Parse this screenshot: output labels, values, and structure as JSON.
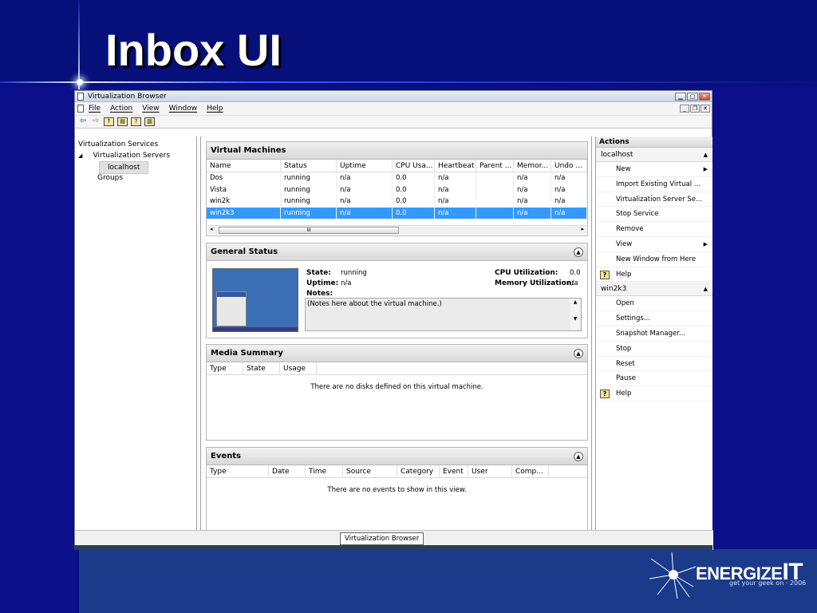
{
  "slide": {
    "title": "Inbox UI",
    "logo": {
      "brand": "ENERGIZE",
      "brand_suffix": "IT",
      "tagline": "get your geek on · 2006"
    }
  },
  "window": {
    "title": "Virtualization Browser",
    "menu": [
      "File",
      "Action",
      "View",
      "Window",
      "Help"
    ]
  },
  "tree": {
    "root": "Virtualization Services",
    "servers": "Virtualization Servers",
    "host": "localhost",
    "groups": "Groups"
  },
  "vm": {
    "heading": "Virtual Machines",
    "columns": [
      "Name",
      "Status",
      "Uptime",
      "CPU Usa...",
      "Heartbeat",
      "Parent ...",
      "Memor...",
      "Undo ..."
    ],
    "rows": [
      [
        "Dos",
        "running",
        "n/a",
        "0.0",
        "n/a",
        "",
        "n/a",
        "n/a"
      ],
      [
        "Vista",
        "running",
        "n/a",
        "0.0",
        "n/a",
        "",
        "n/a",
        "n/a"
      ],
      [
        "win2k",
        "running",
        "n/a",
        "0.0",
        "n/a",
        "",
        "n/a",
        "n/a"
      ],
      [
        "win2k3",
        "running",
        "n/a",
        "0.0",
        "n/a",
        "",
        "n/a",
        "n/a"
      ]
    ],
    "scroll_thumb": "III"
  },
  "general": {
    "heading": "General Status",
    "state_label": "State:",
    "state": "running",
    "uptime_label": "Uptime:",
    "uptime": "n/a",
    "notes_label": "Notes:",
    "cpu_label": "CPU Utilization:",
    "cpu": "0.0",
    "mem_label": "Memory Utilization:",
    "mem": "n/a",
    "notes_text": "(Notes here about the virtual machine.)"
  },
  "media": {
    "heading": "Media Summary",
    "columns": [
      "Type",
      "State",
      "Usage"
    ],
    "empty": "There are no disks defined on this virtual machine."
  },
  "events": {
    "heading": "Events",
    "columns": [
      "Type",
      "Date",
      "Time",
      "Source",
      "Category",
      "Event",
      "User",
      "Comp..."
    ],
    "empty": "There are no events to show in this view."
  },
  "actions": {
    "heading": "Actions",
    "group1": "localhost",
    "group1_items": [
      "New",
      "Import Existing Virtual ...",
      "Virtualization Server Se...",
      "Stop Service",
      "Remove",
      "View",
      "New Window from Here",
      "Help"
    ],
    "group2": "win2k3",
    "group2_items": [
      "Open",
      "Settings...",
      "Snapshot Manager...",
      "Stop",
      "Reset",
      "Pause",
      "Help"
    ]
  },
  "status": {
    "tooltip": "Virtualization Browser"
  }
}
